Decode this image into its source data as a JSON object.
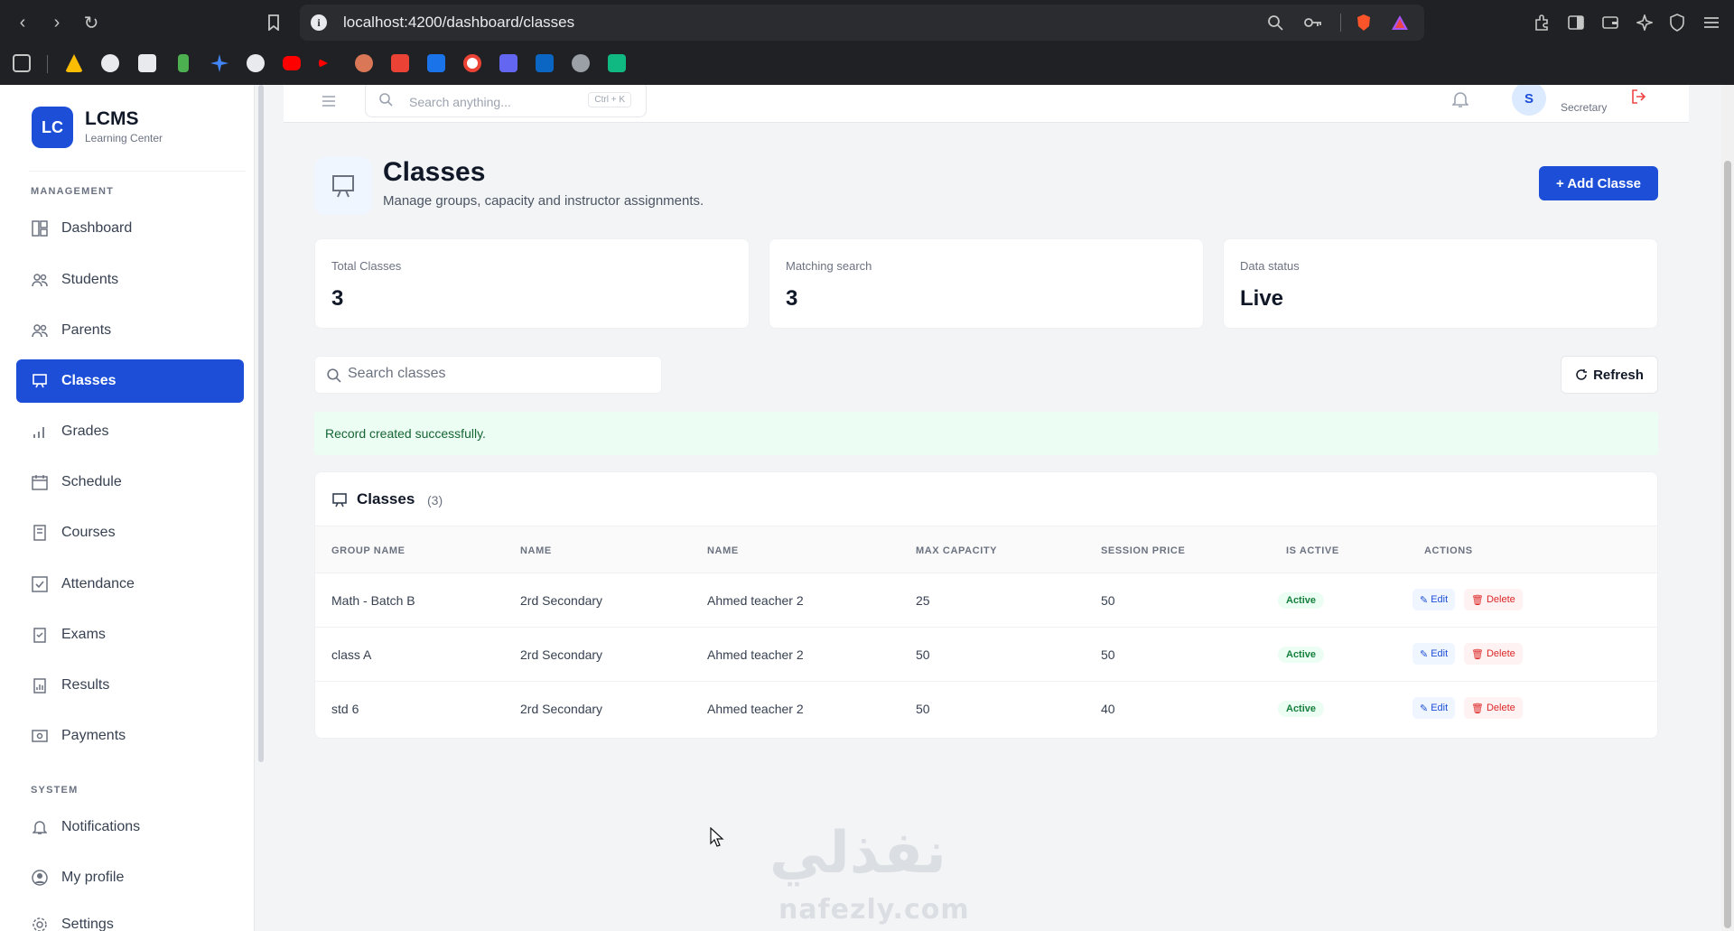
{
  "browser": {
    "url": "localhost:4200/dashboard/classes",
    "info_glyph": "i"
  },
  "sidebar": {
    "logo": "LC",
    "brand": "LCMS",
    "brand_sub": "Learning Center",
    "sections": [
      "MANAGEMENT",
      "SYSTEM"
    ],
    "items": [
      {
        "label": "Dashboard",
        "icon": "dashboard-icon"
      },
      {
        "label": "Students",
        "icon": "students-icon"
      },
      {
        "label": "Parents",
        "icon": "parents-icon"
      },
      {
        "label": "Classes",
        "icon": "classes-icon",
        "active": true
      },
      {
        "label": "Grades",
        "icon": "grades-icon"
      },
      {
        "label": "Schedule",
        "icon": "schedule-icon"
      },
      {
        "label": "Courses",
        "icon": "courses-icon"
      },
      {
        "label": "Attendance",
        "icon": "attendance-icon"
      },
      {
        "label": "Exams",
        "icon": "exams-icon"
      },
      {
        "label": "Results",
        "icon": "results-icon"
      },
      {
        "label": "Payments",
        "icon": "payments-icon"
      }
    ],
    "system_items": [
      {
        "label": "Notifications",
        "icon": "bell-icon"
      },
      {
        "label": "My profile",
        "icon": "profile-icon"
      },
      {
        "label": "Settings",
        "icon": "gear-icon"
      }
    ]
  },
  "topbar": {
    "search_placeholder": "Search anything...",
    "search_shortcut": "Ctrl + K",
    "avatar_initial": "S",
    "role": "Secretary"
  },
  "page": {
    "title": "Classes",
    "subtitle": "Manage groups, capacity and instructor assignments.",
    "add_button": "+ Add Classe"
  },
  "stats": [
    {
      "label": "Total Classes",
      "value": "3"
    },
    {
      "label": "Matching search",
      "value": "3"
    },
    {
      "label": "Data status",
      "value": "Live"
    }
  ],
  "search": {
    "placeholder": "Search classes"
  },
  "refresh_label": "Refresh",
  "alert": "Record created successfully.",
  "table": {
    "title": "Classes",
    "count": "(3)",
    "columns": [
      "GROUP NAME",
      "NAME",
      "NAME",
      "MAX CAPACITY",
      "SESSION PRICE",
      "IS ACTIVE",
      "ACTIONS"
    ],
    "rows": [
      {
        "group": "Math - Batch B",
        "level": "2rd Secondary",
        "teacher": "Ahmed teacher 2",
        "capacity": "25",
        "price": "50",
        "status": "Active"
      },
      {
        "group": "class A",
        "level": "2rd Secondary",
        "teacher": "Ahmed teacher 2",
        "capacity": "50",
        "price": "50",
        "status": "Active"
      },
      {
        "group": "std 6",
        "level": "2rd Secondary",
        "teacher": "Ahmed teacher 2",
        "capacity": "50",
        "price": "40",
        "status": "Active"
      }
    ],
    "edit_label": "Edit",
    "delete_label": "Delete"
  },
  "watermark": {
    "arabic": "نفذلي",
    "latin": "nafezly.com"
  },
  "colors": {
    "accent": "#1d4ed8",
    "success_bg": "#ecfdf3",
    "success_text": "#15803d",
    "danger": "#dc2626"
  }
}
